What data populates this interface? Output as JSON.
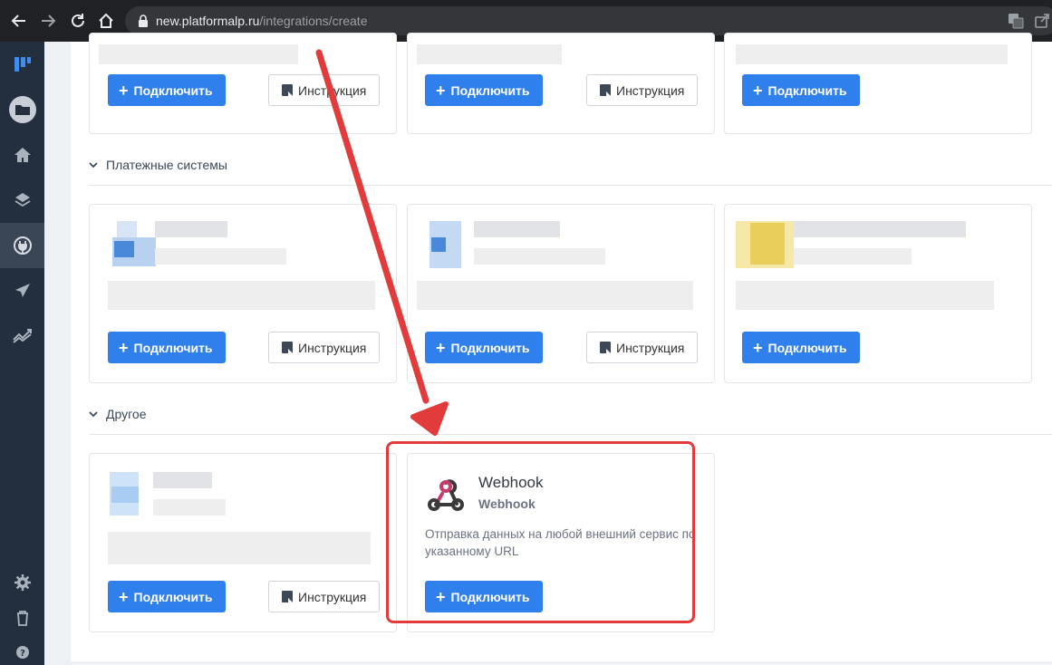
{
  "browser": {
    "url_host": "new.platformalp.ru",
    "url_path": "/integrations/create"
  },
  "sidebar": {
    "items": [
      {
        "icon": "logo-icon"
      },
      {
        "icon": "folder-icon"
      },
      {
        "icon": "home-icon"
      },
      {
        "icon": "layers-icon"
      },
      {
        "icon": "plug-icon"
      },
      {
        "icon": "send-icon"
      },
      {
        "icon": "chart-icon"
      },
      {
        "icon": "gear-icon"
      },
      {
        "icon": "trash-icon"
      },
      {
        "icon": "help-icon"
      }
    ]
  },
  "sections": {
    "payments": "Платежные системы",
    "other": "Другое"
  },
  "buttons": {
    "connect": "Подключить",
    "instructions": "Инструкция"
  },
  "webhook": {
    "title": "Webhook",
    "subtitle": "Webhook",
    "description": "Отправка данных на любой внешний сервис по указанному URL"
  },
  "colors": {
    "primary": "#2f80ed",
    "highlight": "#e23b3b",
    "sidebar": "#232f3e"
  }
}
